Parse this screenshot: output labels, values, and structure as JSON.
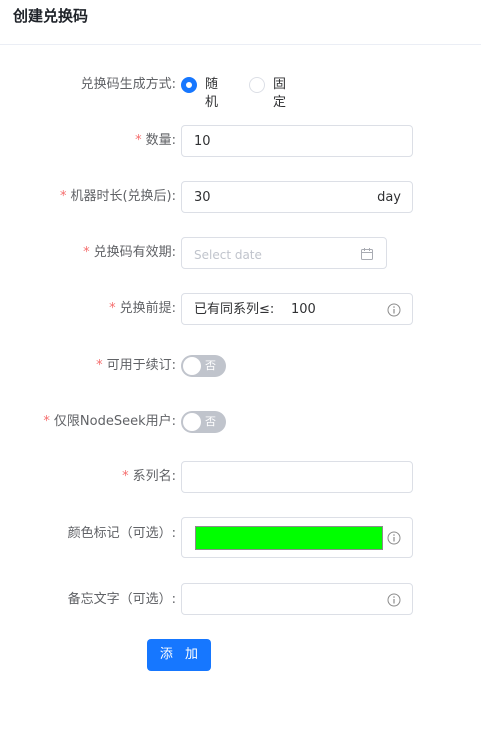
{
  "header": {
    "title": "创建兑换码"
  },
  "form": {
    "gen_mode": {
      "label": "兑换码生成方式:",
      "options": [
        "随机",
        "固定"
      ],
      "selected": "随机"
    },
    "quantity": {
      "label": "数量:",
      "value": "10"
    },
    "duration": {
      "label": "机器时长(兑换后):",
      "value": "30",
      "suffix": "day"
    },
    "validity": {
      "label": "兑换码有效期:",
      "placeholder": "Select date"
    },
    "prerequisite": {
      "label": "兑换前提:",
      "prefix": "已有同系列≤:",
      "value": "100"
    },
    "renewal": {
      "label": "可用于续订:",
      "state": "否"
    },
    "nodeseek_only": {
      "label": "仅限NodeSeek用户:",
      "state": "否"
    },
    "series_name": {
      "label": "系列名:",
      "value": ""
    },
    "color_tag": {
      "label": "颜色标记（可选）:",
      "color": "#00ff00"
    },
    "memo": {
      "label": "备忘文字（可选）:",
      "value": ""
    }
  },
  "actions": {
    "add_label": "添 加"
  },
  "colors": {
    "accent": "#1677ff",
    "required": "#f56c6c",
    "switch_off": "#c0c4cc"
  }
}
